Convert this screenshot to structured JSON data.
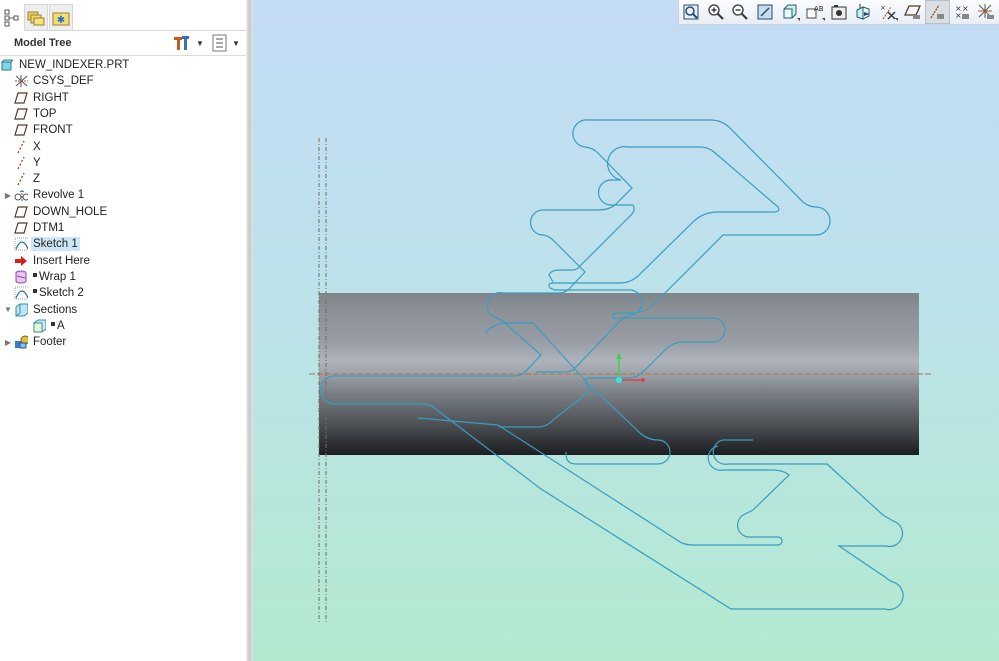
{
  "left_panel": {
    "tabs": [
      {
        "name": "model-tree-tab",
        "icon": "model-tree-icon",
        "active": true
      },
      {
        "name": "folder-browser-tab",
        "icon": "folders-icon",
        "active": false
      },
      {
        "name": "favorites-tab",
        "icon": "favorites-folder-icon",
        "active": false
      }
    ],
    "header": {
      "title": "Model Tree",
      "settings_icon": "tools-icon",
      "show_icon": "list-settings-icon"
    },
    "tree": [
      {
        "label": "NEW_INDEXER.PRT",
        "icon": "part-icon",
        "indent": 0,
        "expander": "",
        "selected": false,
        "marker": false
      },
      {
        "label": "CSYS_DEF",
        "icon": "csys-icon",
        "indent": 1,
        "expander": "",
        "selected": false,
        "marker": false
      },
      {
        "label": "RIGHT",
        "icon": "datum-plane-icon",
        "indent": 1,
        "expander": "",
        "selected": false,
        "marker": false
      },
      {
        "label": "TOP",
        "icon": "datum-plane-icon",
        "indent": 1,
        "expander": "",
        "selected": false,
        "marker": false
      },
      {
        "label": "FRONT",
        "icon": "datum-plane-icon",
        "indent": 1,
        "expander": "",
        "selected": false,
        "marker": false
      },
      {
        "label": "X",
        "icon": "datum-axis-icon",
        "indent": 1,
        "expander": "",
        "selected": false,
        "marker": false
      },
      {
        "label": "Y",
        "icon": "datum-axis-icon",
        "indent": 1,
        "expander": "",
        "selected": false,
        "marker": false
      },
      {
        "label": "Z",
        "icon": "datum-axis-icon",
        "indent": 1,
        "expander": "",
        "selected": false,
        "marker": false
      },
      {
        "label": "Revolve 1",
        "icon": "revolve-icon",
        "indent": 1,
        "expander": "▶",
        "selected": false,
        "marker": false
      },
      {
        "label": "DOWN_HOLE",
        "icon": "datum-plane-icon",
        "indent": 1,
        "expander": "",
        "selected": false,
        "marker": false
      },
      {
        "label": "DTM1",
        "icon": "datum-plane-icon",
        "indent": 1,
        "expander": "",
        "selected": false,
        "marker": false
      },
      {
        "label": "Sketch 1",
        "icon": "sketch-icon",
        "indent": 1,
        "expander": "",
        "selected": true,
        "marker": false
      },
      {
        "label": "Insert Here",
        "icon": "insert-here-arrow-icon",
        "indent": 1,
        "expander": "",
        "selected": false,
        "marker": false
      },
      {
        "label": "Wrap 1",
        "icon": "wrap-icon",
        "indent": 1,
        "expander": "",
        "selected": false,
        "marker": true
      },
      {
        "label": "Sketch 2",
        "icon": "sketch-icon",
        "indent": 1,
        "expander": "",
        "selected": false,
        "marker": true
      },
      {
        "label": "Sections",
        "icon": "sections-icon",
        "indent": 1,
        "expander": "▼",
        "selected": false,
        "marker": false
      },
      {
        "label": "A",
        "icon": "section-icon",
        "indent": 2,
        "expander": "",
        "selected": false,
        "marker": true
      },
      {
        "label": "Footer",
        "icon": "footer-icon",
        "indent": 1,
        "expander": "▶",
        "selected": false,
        "marker": false
      }
    ]
  },
  "viewport": {
    "toolbar": [
      {
        "name": "refit",
        "icon": "refit-icon",
        "dropdown": false,
        "active": false
      },
      {
        "name": "zoom-in",
        "icon": "zoom-in-icon",
        "dropdown": false,
        "active": false
      },
      {
        "name": "zoom-out",
        "icon": "zoom-out-icon",
        "dropdown": false,
        "active": false
      },
      {
        "name": "repaint",
        "icon": "repaint-icon",
        "dropdown": false,
        "active": false
      },
      {
        "name": "display-style",
        "icon": "display-style-icon",
        "dropdown": true,
        "active": false
      },
      {
        "name": "saved-views",
        "icon": "saved-orientations-icon",
        "dropdown": true,
        "active": false
      },
      {
        "name": "view-manager",
        "icon": "view-manager-icon",
        "dropdown": false,
        "active": false
      },
      {
        "name": "perspective",
        "icon": "perspective-view-icon",
        "dropdown": false,
        "active": false
      },
      {
        "name": "datum-display",
        "icon": "datum-display-filters-icon",
        "dropdown": true,
        "active": false
      },
      {
        "name": "plane-display",
        "icon": "plane-display-icon",
        "dropdown": false,
        "active": false
      },
      {
        "name": "axis-display",
        "icon": "axis-display-icon",
        "dropdown": false,
        "active": true
      },
      {
        "name": "point-display",
        "icon": "point-display-icon",
        "dropdown": false,
        "active": false
      },
      {
        "name": "csys-display",
        "icon": "csys-display-icon",
        "dropdown": false,
        "active": false
      }
    ],
    "colors": {
      "sketch": "#3a9cc0",
      "axis_line": "#b0704a",
      "csys_x": "#e0404a",
      "csys_y": "#40d050",
      "csys_origin": "#40e0e8"
    }
  }
}
